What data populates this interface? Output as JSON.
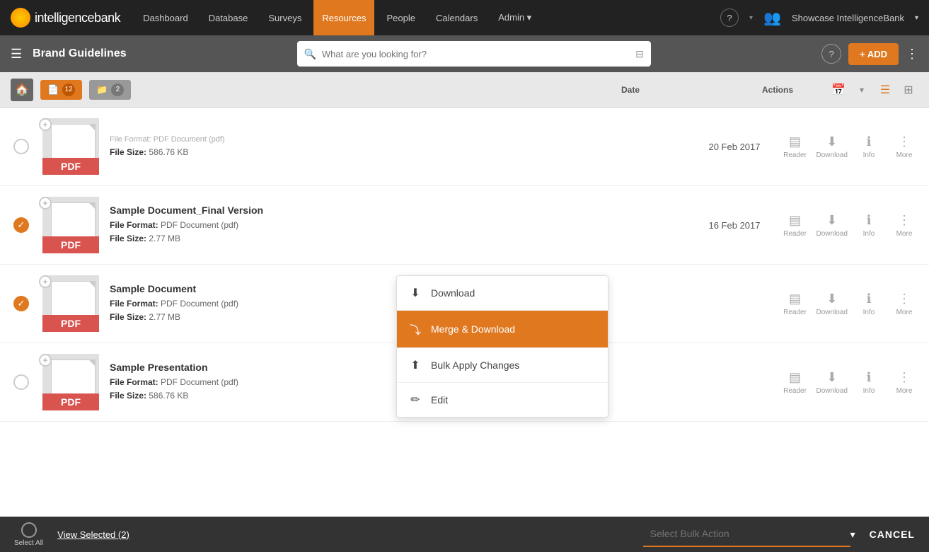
{
  "nav": {
    "logo_text": "intelligencebank",
    "items": [
      {
        "label": "Dashboard",
        "active": false
      },
      {
        "label": "Database",
        "active": false
      },
      {
        "label": "Surveys",
        "active": false
      },
      {
        "label": "Resources",
        "active": true
      },
      {
        "label": "People",
        "active": false
      },
      {
        "label": "Calendars",
        "active": false
      },
      {
        "label": "Admin",
        "active": false,
        "dropdown": true
      }
    ],
    "user_name": "Showcase IntelligenceBank",
    "add_label": "+ ADD"
  },
  "sub_header": {
    "title": "Brand Guidelines",
    "search_placeholder": "What are you looking for?"
  },
  "toolbar": {
    "doc_count": "12",
    "folder_count": "2",
    "date_col": "Date",
    "actions_col": "Actions"
  },
  "files": [
    {
      "id": "file-1",
      "name": "",
      "format_label": "File Format:",
      "format_value": "PDF Document (pdf)",
      "size_label": "File Size:",
      "size_value": "586.76 KB",
      "date": "20 Feb 2017",
      "checked": false
    },
    {
      "id": "file-2",
      "name": "Sample Document_Final Version",
      "format_label": "File Format:",
      "format_value": "PDF Document (pdf)",
      "size_label": "File Size:",
      "size_value": "2.77 MB",
      "date": "16 Feb 2017",
      "checked": true
    },
    {
      "id": "file-3",
      "name": "Sample Document",
      "format_label": "File Format:",
      "format_value": "PDF Document (pdf)",
      "size_label": "File Size:",
      "size_value": "2.77 MB",
      "date": "",
      "checked": true
    },
    {
      "id": "file-4",
      "name": "Sample Presentation",
      "format_label": "File Format:",
      "format_value": "PDF Document (pdf)",
      "size_label": "File Size:",
      "size_value": "586.76 KB",
      "date": "",
      "checked": false
    }
  ],
  "actions": [
    {
      "icon": "reader",
      "label": "Reader"
    },
    {
      "icon": "download",
      "label": "Download"
    },
    {
      "icon": "info",
      "label": "Info"
    },
    {
      "icon": "more",
      "label": "More"
    }
  ],
  "bulk_dropdown": {
    "items": [
      {
        "icon": "⬇",
        "label": "Download",
        "active": false
      },
      {
        "icon": "⤵",
        "label": "Merge & Download",
        "active": true
      },
      {
        "icon": "⬆",
        "label": "Bulk Apply Changes",
        "active": false
      },
      {
        "icon": "✏",
        "label": "Edit",
        "active": false
      }
    ]
  },
  "bottom_bar": {
    "select_all_label": "Select All",
    "view_selected_label": "View Selected (2)",
    "bulk_action_placeholder": "Select Bulk Action",
    "cancel_label": "CANCEL"
  }
}
